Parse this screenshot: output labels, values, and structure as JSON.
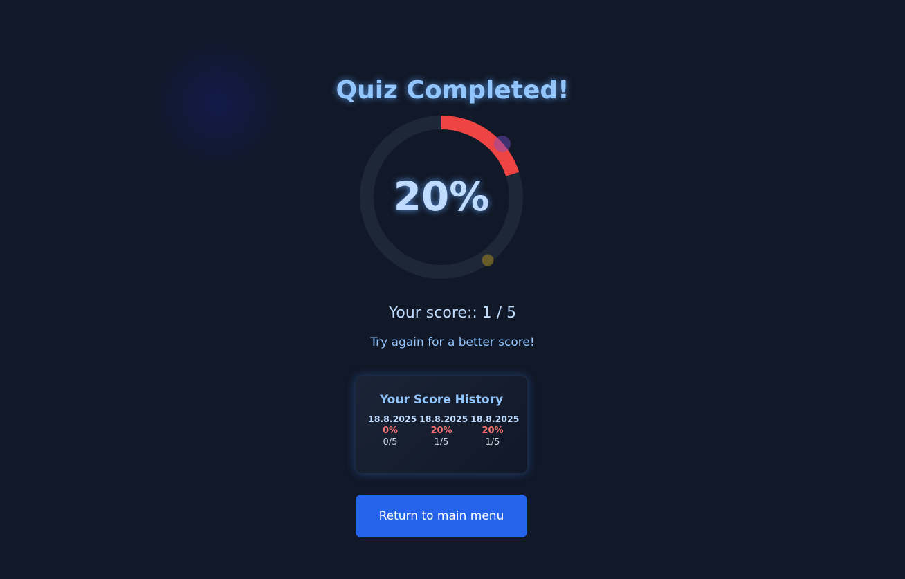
{
  "title": "Quiz Completed!",
  "result": {
    "percent_label": "20%",
    "percent": 20,
    "score_text": "Your score:: 1 / 5",
    "message": "Try again for a better score!"
  },
  "history": {
    "heading": "Your Score History",
    "entries": [
      {
        "date": "18.8.2025",
        "percent": "0%",
        "fraction": "0/5"
      },
      {
        "date": "18.8.2025",
        "percent": "20%",
        "fraction": "1/5"
      },
      {
        "date": "18.8.2025",
        "percent": "20%",
        "fraction": "1/5"
      }
    ]
  },
  "button": {
    "label": "Return to main menu"
  },
  "colors": {
    "accent": "#ef4444",
    "track": "#1f2937",
    "button": "#2563eb"
  }
}
